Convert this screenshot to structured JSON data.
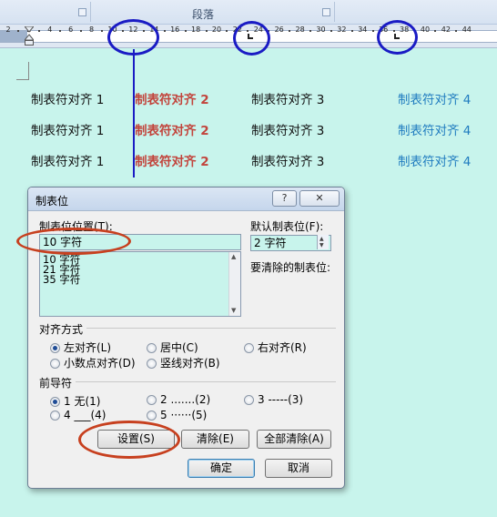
{
  "ribbon": {
    "group_title": "段落"
  },
  "ruler": {
    "labels": [
      "2",
      "2",
      "4",
      "6",
      "8",
      "10",
      "12",
      "14",
      "16",
      "18",
      "20",
      "22",
      "24",
      "26",
      "28",
      "30",
      "32",
      "34",
      "36",
      "38",
      "40",
      "42",
      "44"
    ]
  },
  "document": {
    "rows": [
      [
        "制表符对齐 1",
        "制表符对齐 2",
        "制表符对齐 3",
        "制表符对齐 4"
      ],
      [
        "制表符对齐 1",
        "制表符对齐 2",
        "制表符对齐 3",
        "制表符对齐 4"
      ],
      [
        "制表符对齐 1",
        "制表符对齐 2",
        "制表符对齐 3",
        "制表符对齐 4"
      ]
    ],
    "colors": {
      "col1": "#111111",
      "col2": "#c2443c",
      "col3": "#111111",
      "col4": "#1f7bbf"
    }
  },
  "dialog": {
    "title": "制表位",
    "help_glyph": "?",
    "close_glyph": "✕",
    "tab_position_label": "制表位位置(T):",
    "tab_position_value": "10 字符",
    "tab_list": [
      "10 字符",
      "21 字符",
      "35 字符"
    ],
    "default_tab_label": "默认制表位(F):",
    "default_tab_value": "2 字符",
    "clear_label": "要清除的制表位:",
    "alignment": {
      "title": "对齐方式",
      "options": [
        "左对齐(L)",
        "居中(C)",
        "右对齐(R)",
        "小数点对齐(D)",
        "竖线对齐(B)"
      ],
      "selected": "左对齐(L)"
    },
    "leader": {
      "title": "前导符",
      "options": [
        "1 无(1)",
        "2 .......(2)",
        "3 -----(3)",
        "4 ___(4)",
        "5 ······(5)"
      ],
      "selected": "1 无(1)"
    },
    "buttons": {
      "set": "设置(S)",
      "clear": "清除(E)",
      "clear_all": "全部清除(A)",
      "ok": "确定",
      "cancel": "取消"
    }
  },
  "annotation_colors": {
    "blue": "#1a1bc4",
    "red": "#c7401f"
  }
}
